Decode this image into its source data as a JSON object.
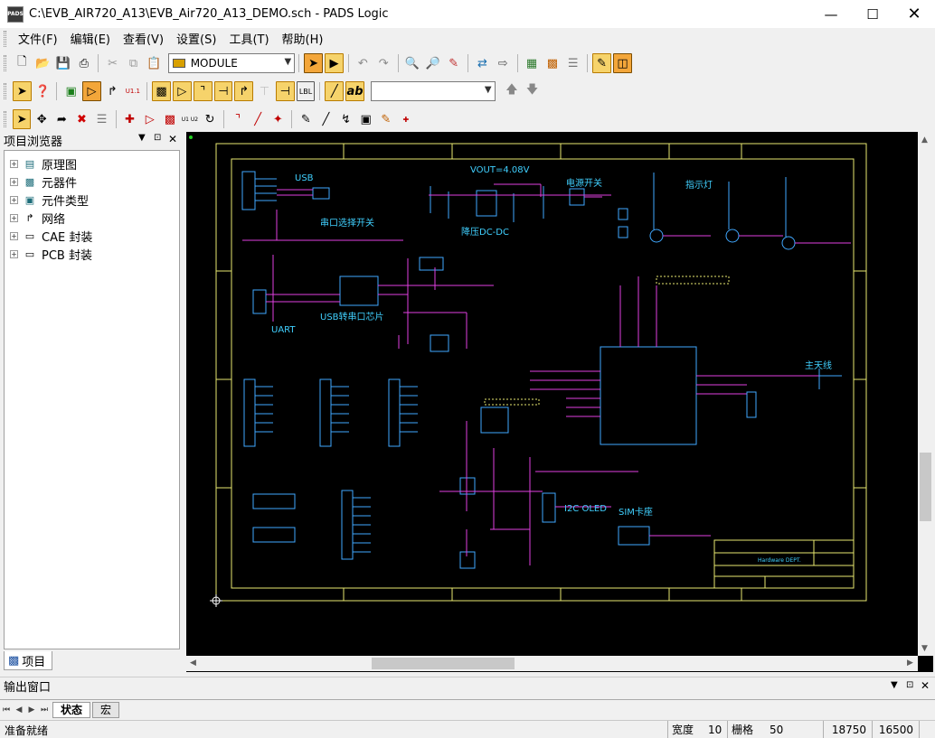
{
  "window": {
    "icon_label": "PADS",
    "title": "C:\\EVB_AIR720_A13\\EVB_Air720_A13_DEMO.sch - PADS Logic"
  },
  "menu": [
    "文件(F)",
    "编辑(E)",
    "查看(V)",
    "设置(S)",
    "工具(T)",
    "帮助(H)"
  ],
  "toolbar": {
    "module_combo": "MODULE",
    "search_combo": "",
    "lbl_button": "LBL",
    "ab_button": "ab",
    "u11_button": "U1.1",
    "u1u2_button": "U1 U2"
  },
  "project_browser": {
    "title": "项目浏览器",
    "items": [
      {
        "label": "原理图",
        "icon": "schematic-icon"
      },
      {
        "label": "元器件",
        "icon": "components-icon"
      },
      {
        "label": "元件类型",
        "icon": "part-types-icon"
      },
      {
        "label": "网络",
        "icon": "nets-icon"
      },
      {
        "label": "CAE 封装",
        "icon": "cae-decal-icon"
      },
      {
        "label": "PCB 封装",
        "icon": "pcb-decal-icon"
      }
    ],
    "tab": "项目"
  },
  "schematic": {
    "labels": [
      "USB",
      "VOUT=4.08V",
      "电源开关",
      "指示灯",
      "串口选择开关",
      "降压DC-DC",
      "USB转串口芯片",
      "UART",
      "主天线",
      "I2C OLED",
      "SIM卡座",
      "Hardware DEPT."
    ]
  },
  "output_window": {
    "title": "输出窗口",
    "tabs": [
      "状态",
      "宏"
    ]
  },
  "status": {
    "message": "准备就绪",
    "width_label": "宽度",
    "width_value": "10",
    "grid_label": "栅格",
    "grid_value": "50",
    "x": "18750",
    "y": "16500"
  },
  "colors": {
    "canvas": "#000000",
    "border": "#e8e870",
    "wire": "#e040e0",
    "part": "#40a8ff",
    "text": "#40d0ff",
    "dim": "#a0a0a0"
  }
}
